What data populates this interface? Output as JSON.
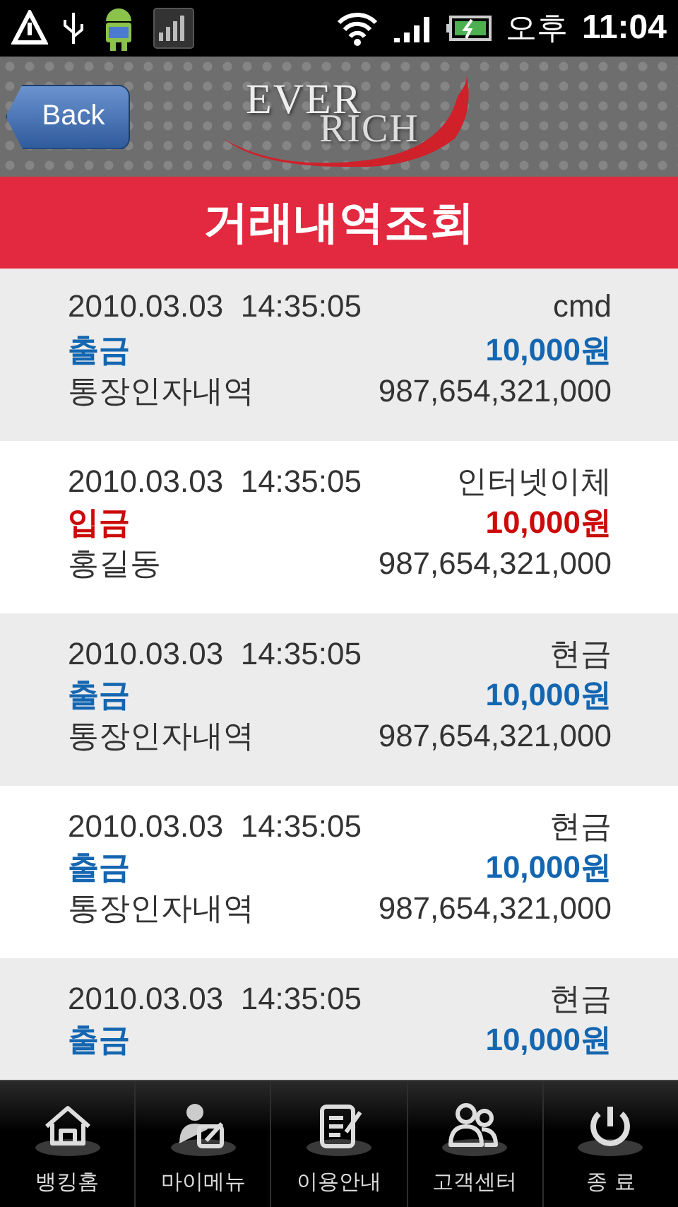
{
  "status_bar": {
    "time_period": "오후",
    "time": "11:04"
  },
  "header": {
    "back_button": "Back",
    "logo": {
      "top": "EVER",
      "bottom": "RICH"
    }
  },
  "title": "거래내역조회",
  "transactions": [
    {
      "datetime": "2010.03.03  14:35:05",
      "method": "cmd",
      "kind": "withdrawal",
      "type": "출금",
      "amount": "10,000원",
      "memo": "통장인자내역",
      "balance": "987,654,321,000"
    },
    {
      "datetime": "2010.03.03  14:35:05",
      "method": "인터넷이체",
      "kind": "deposit",
      "type": "입금",
      "amount": "10,000원",
      "memo": "홍길동",
      "balance": "987,654,321,000"
    },
    {
      "datetime": "2010.03.03  14:35:05",
      "method": "현금",
      "kind": "withdrawal",
      "type": "출금",
      "amount": "10,000원",
      "memo": "통장인자내역",
      "balance": "987,654,321,000"
    },
    {
      "datetime": "2010.03.03  14:35:05",
      "method": "현금",
      "kind": "withdrawal",
      "type": "출금",
      "amount": "10,000원",
      "memo": "통장인자내역",
      "balance": "987,654,321,000"
    },
    {
      "datetime": "2010.03.03  14:35:05",
      "method": "현금",
      "kind": "withdrawal",
      "type": "출금",
      "amount": "10,000원"
    }
  ],
  "bottom_nav": [
    {
      "kind": "home",
      "label": "뱅킹홈"
    },
    {
      "kind": "mymenu",
      "label": "마이메뉴"
    },
    {
      "kind": "guide",
      "label": "이용안내"
    },
    {
      "kind": "support",
      "label": "고객센터"
    },
    {
      "kind": "exit",
      "label": "종 료"
    }
  ]
}
